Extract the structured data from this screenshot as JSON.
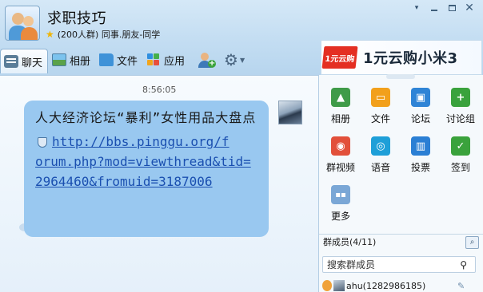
{
  "header": {
    "title": "求职技巧",
    "subtitle": "(200人群) 同事.朋友-同学",
    "window_controls": [
      "pin",
      "minimize",
      "maximize",
      "close"
    ]
  },
  "toolbar": {
    "tabs": [
      {
        "label": "聊天",
        "icon": "chat-icon",
        "active": true
      },
      {
        "label": "相册",
        "icon": "album-icon",
        "active": false
      },
      {
        "label": "文件",
        "icon": "folder-icon",
        "active": false
      },
      {
        "label": "应用",
        "icon": "apps-icon",
        "active": false
      }
    ],
    "extra_icons": [
      "add-member-icon",
      "settings-gear-icon"
    ]
  },
  "ad": {
    "logo_text": "1元云购",
    "text": "1元云购小米3"
  },
  "chat": {
    "timestamp": "8:56:05",
    "message": {
      "text": "人大经济论坛“暴利”女性用品大盘点",
      "link_first": "http://bbs.pinggu.org/f",
      "link_rest": "orum.php?mod=viewthread&tid=2964460&fromuid=3187006"
    }
  },
  "apps": [
    {
      "label": "相册",
      "icon": "photo-icon",
      "color": "#3f9b48"
    },
    {
      "label": "文件",
      "icon": "folder-icon",
      "color": "#f2a01b"
    },
    {
      "label": "论坛",
      "icon": "forum-icon",
      "color": "#2f84d6"
    },
    {
      "label": "讨论组",
      "icon": "discussion-icon",
      "color": "#3aa23c"
    },
    {
      "label": "群视频",
      "icon": "video-icon",
      "color": "#e2503a"
    },
    {
      "label": "语音",
      "icon": "voice-icon",
      "color": "#1e9fd8"
    },
    {
      "label": "投票",
      "icon": "vote-icon",
      "color": "#2b7fd4"
    },
    {
      "label": "签到",
      "icon": "checkin-icon",
      "color": "#3aa23c"
    },
    {
      "label": "更多",
      "icon": "more-icon",
      "color": "#7aa7d6"
    }
  ],
  "members": {
    "header": "群成员(4/11)",
    "search_placeholder": "搜索群成员",
    "list": [
      {
        "name": "ahu(1282986185)"
      }
    ]
  }
}
